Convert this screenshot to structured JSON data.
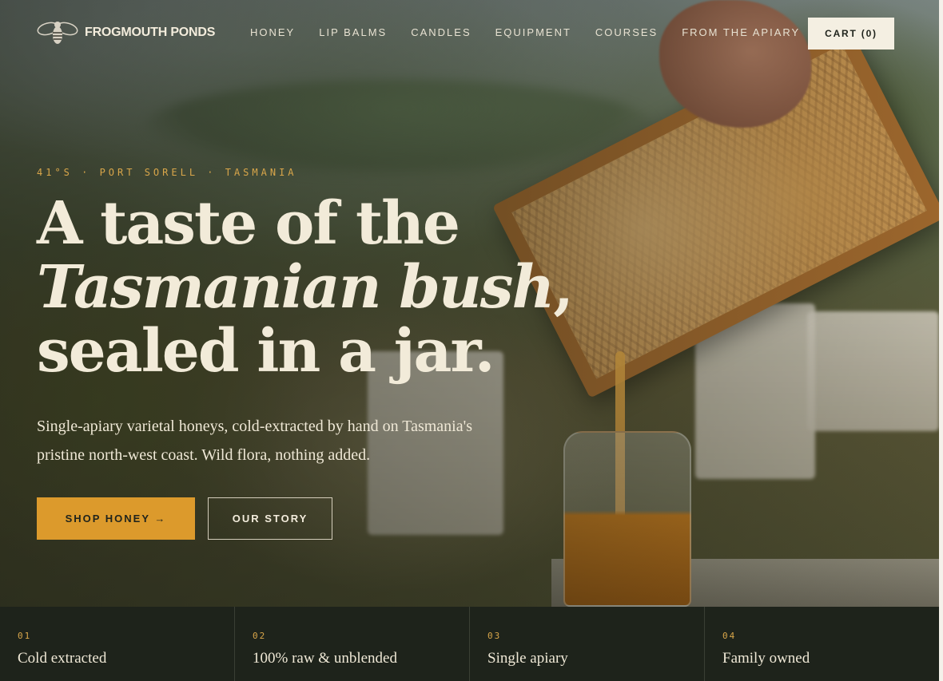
{
  "brand": {
    "name": "FROGMOUTH PONDS",
    "logo_icon": "bee-icon"
  },
  "nav": {
    "items": [
      "HONEY",
      "LIP BALMS",
      "CANDLES",
      "EQUIPMENT",
      "COURSES",
      "FROM THE APIARY"
    ],
    "cart_label": "CART (0)"
  },
  "hero": {
    "eyebrow": "41°S · PORT SORELL · TASMANIA",
    "headline_part1": "A taste of the",
    "headline_italic": "Tasmanian bush",
    "headline_part2": ", sealed in a jar.",
    "subtext": "Single-apiary varietal honeys, cold-extracted by hand on Tasmania's pristine north-west coast. Wild flora, nothing added.",
    "primary_cta": "SHOP HONEY →",
    "secondary_cta": "OUR STORY"
  },
  "features": [
    {
      "num": "01",
      "title": "Cold extracted"
    },
    {
      "num": "02",
      "title": "100% raw & unblended"
    },
    {
      "num": "03",
      "title": "Single apiary"
    },
    {
      "num": "04",
      "title": "Family owned"
    }
  ],
  "colors": {
    "accent": "#dc9a2c",
    "eyebrow": "#d9a64a",
    "dark": "#1e231b",
    "cream": "#f4efe2"
  }
}
